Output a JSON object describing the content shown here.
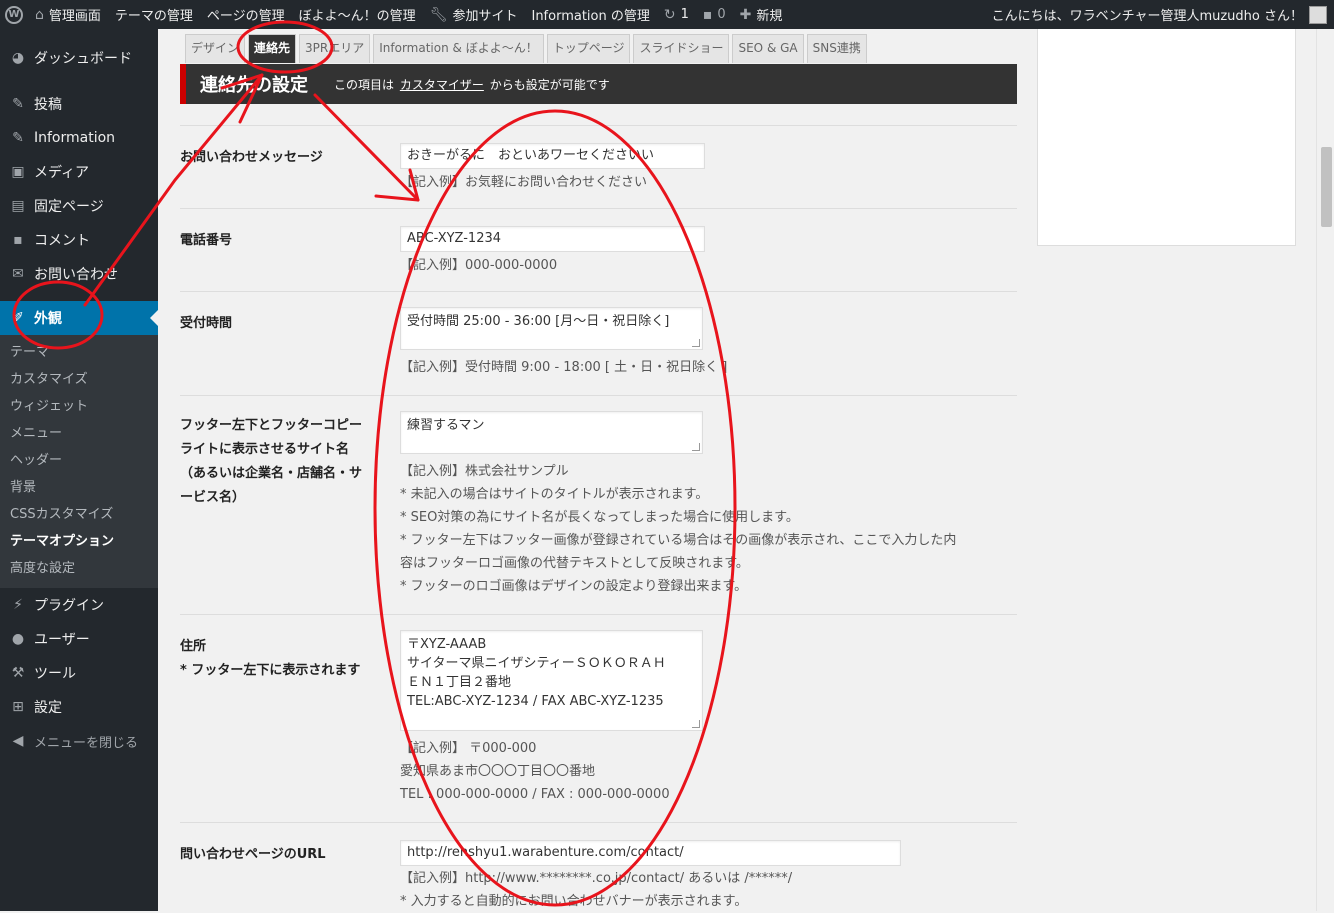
{
  "adminbar": {
    "items": [
      "管理画面",
      "テーマの管理",
      "ページの管理",
      "ぼよよ～ん！の管理",
      "参加サイト",
      "Information の管理",
      "1",
      "0",
      "新規"
    ],
    "greeting": "こんにちは、ワラベンチャー管理人muzudho さん！"
  },
  "sidebar": {
    "items": [
      {
        "label": "ダッシュボード",
        "icon": "dashboard-icon"
      },
      {
        "label": "投稿",
        "icon": "pin-icon"
      },
      {
        "label": "Information",
        "icon": "pin-icon"
      },
      {
        "label": "メディア",
        "icon": "media-icon"
      },
      {
        "label": "固定ページ",
        "icon": "page-icon"
      },
      {
        "label": "コメント",
        "icon": "comment-icon"
      },
      {
        "label": "お問い合わせ",
        "icon": "mail-icon"
      },
      {
        "label": "外観",
        "icon": "brush-icon"
      }
    ],
    "submenu": [
      "テーマ",
      "カスタマイズ",
      "ウィジェット",
      "メニュー",
      "ヘッダー",
      "背景",
      "CSSカスタマイズ",
      "テーマオプション",
      "高度な設定"
    ],
    "lower_items": [
      {
        "label": "プラグイン",
        "icon": "plugin-icon"
      },
      {
        "label": "ユーザー",
        "icon": "user-icon"
      },
      {
        "label": "ツール",
        "icon": "wrench-icon"
      },
      {
        "label": "設定",
        "icon": "settings-icon"
      }
    ],
    "collapse": "メニューを閉じる"
  },
  "tabs": [
    "デザイン",
    "連絡先",
    "3PRエリア",
    "Information & ぼよよ～ん！",
    "トップページ",
    "スライドショー",
    "SEO & GA",
    "SNS連携"
  ],
  "section": {
    "title": "連絡先の設定",
    "desc_pre": "この項目は",
    "desc_link": "カスタマイザー",
    "desc_post": "からも設定が可能です"
  },
  "fields": {
    "message": {
      "label": "お問い合わせメッセージ",
      "value": "おきーがるに　おといあワーセくださいい",
      "note": "【記入例】お気軽にお問い合わせください"
    },
    "phone": {
      "label": "電話番号",
      "value": "ABC-XYZ-1234",
      "note": "【記入例】000-000-0000"
    },
    "hours": {
      "label": "受付時間",
      "value": "受付時間 25:00 - 36:00 [月～日・祝日除く]",
      "note": "【記入例】受付時間 9:00 - 18:00 [ 土・日・祝日除く ]"
    },
    "footer_name": {
      "label_lines": [
        "フッター左下とフッターコピー",
        "ライトに表示させるサイト名",
        "（あるいは企業名・店舗名・サ",
        "ービス名）"
      ],
      "value": "練習するマン",
      "notes": [
        "【記入例】株式会社サンプル",
        "* 未記入の場合はサイトのタイトルが表示されます。",
        "* SEO対策の為にサイト名が長くなってしまった場合に使用します。",
        "* フッター左下はフッター画像が登録されている場合はその画像が表示され、ここで入力した内",
        "容はフッターロゴ画像の代替テキストとして反映されます。",
        "* フッターのロゴ画像はデザインの設定より登録出来ます。"
      ]
    },
    "address": {
      "label_lines": [
        "住所",
        "* フッター左下に表示されます"
      ],
      "value_lines": [
        "〒XYZ-AAAB",
        "サイターマ県ニイザシティーＳＯＫＯＲＡＨ",
        "ＥＮ１丁目２番地",
        "TEL:ABC-XYZ-1234 / FAX ABC-XYZ-1235"
      ],
      "notes": [
        "【記入例】 〒000-000",
        "愛知県あま市〇〇〇丁目〇〇番地",
        "TEL : 000-000-0000 / FAX : 000-000-0000"
      ]
    },
    "contact_url": {
      "label": "問い合わせページのURL",
      "value": "http://renshyu1.warabenture.com/contact/",
      "notes": [
        "【記入例】http://www.********.co.jp/contact/ あるいは /******/",
        "* 入力すると自動的にお問い合わせバナーが表示されます。"
      ]
    }
  },
  "annotation_color": "#e8141c"
}
